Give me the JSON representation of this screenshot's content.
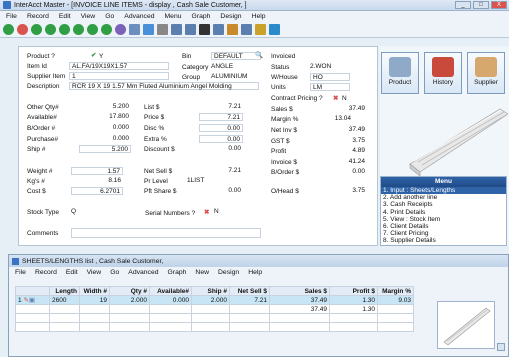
{
  "window": {
    "title": "InterAcct Master - [INVOICE LINE ITEMS - display , Cash Sale Customer, ]",
    "min": "_",
    "max": "□",
    "close": "X"
  },
  "menubar": [
    "File",
    "Record",
    "Edit",
    "View",
    "Go",
    "Advanced",
    "Menu",
    "Graph",
    "Design",
    "Help"
  ],
  "form": {
    "product_label": "Product ?",
    "product_mark": "Y",
    "item_id_label": "Item Id",
    "item_id": "AL.FA/19X19X1.57",
    "supplier_item_label": "Supplier Item",
    "supplier_item": "1",
    "description_label": "Description",
    "description": "RCR 19 X 19 1.57 Mm Fluted Aluminium Angel Molding",
    "bin_label": "Bin",
    "bin": "DEFAULT",
    "category_label": "Category",
    "category": "ANGLE",
    "group_label": "Group",
    "group": "ALUMINIUM",
    "invoiced_label": "Invoiced",
    "status_label": "Status",
    "status": "2.WON",
    "warehouse_label": "W/House",
    "warehouse": "HO",
    "units_label": "Units",
    "units": "LM",
    "contract_pricing_label": "Contract Pricing ?",
    "contract_pricing_mark": "N",
    "other_qty_label": "Other Qty#",
    "other_qty": "5.200",
    "available_label": "Available#",
    "available": "17.800",
    "border_label": "B/Order #",
    "border": "0.000",
    "purchase_label": "Purchase#",
    "purchase": "0.000",
    "ship_label": "Ship #",
    "ship": "5.200",
    "list_label": "List $",
    "list": "7.21",
    "price_label": "Price $",
    "price": "7.21",
    "disc_label": "Disc %",
    "disc": "0.00",
    "extra_label": "Extra %",
    "extra": "0.00",
    "discount_label": "Discount $",
    "discount": "0.00",
    "sales_label": "Sales $",
    "sales": "37.49",
    "margin_label": "Margin %",
    "margin": "13.04",
    "net_inv_label": "Net Inv $",
    "net_inv": "37.49",
    "gst_label": "GST $",
    "gst": "3.75",
    "profit_label": "Profit",
    "profit": "4.89",
    "invoice_label": "Invoice $",
    "invoice": "41.24",
    "border_amt_label": "B/Order $",
    "border_amt": "0.00",
    "ohead_label": "O/Head $",
    "ohead": "3.75",
    "weight_label": "Weight #",
    "weight": "1.57",
    "kgs_label": "Kg's #",
    "kgs": "8.16",
    "cost_label": "Cost $",
    "cost": "6.2701",
    "net_sell_label": "Net Sell $",
    "net_sell": "7.21",
    "pr_level_label": "Pr Level",
    "pr_level": "1LIST",
    "pft_share_label": "Pft Share $",
    "pft_share": "0.00",
    "stock_type_label": "Stock Type",
    "stock_type": "Q",
    "serial_label": "Serial Numbers ?",
    "serial_mark": "N",
    "comments_label": "Comments"
  },
  "side": {
    "product": "Product",
    "history": "History",
    "supplier": "Supplier",
    "menu_title": "Menu",
    "menu_items": [
      "1. Input : Sheets/Lengths",
      "2. Add another line",
      "3. Cash Receipts",
      "4. Print Details",
      "5. View : Stock Item",
      "6. Client Details",
      "7. Client Pricing",
      "8. Supplier Details"
    ]
  },
  "sub": {
    "title": "SHEETS/LENGTHS list , Cash Sale Customer,",
    "menubar": [
      "File",
      "Record",
      "Edit",
      "View",
      "Go",
      "Advanced",
      "Graph",
      "New",
      "Design",
      "Help"
    ],
    "columns": [
      "Length",
      "Width #",
      "Qty #",
      "Available#",
      "Ship #",
      "Net Sell $",
      "Sales $",
      "Profit $",
      "Margin %"
    ],
    "row_number": "1",
    "rows": [
      [
        "2600",
        "19",
        "2.000",
        "0.000",
        "2.000",
        "7.21",
        "37.49",
        "1.30",
        "9.03"
      ]
    ],
    "totals": [
      "",
      "",
      "",
      "",
      "",
      "",
      "37.49",
      "1.30",
      ""
    ]
  },
  "colors": {
    "accent": "#2f63a8",
    "selected_row": "#c7e5f5"
  }
}
